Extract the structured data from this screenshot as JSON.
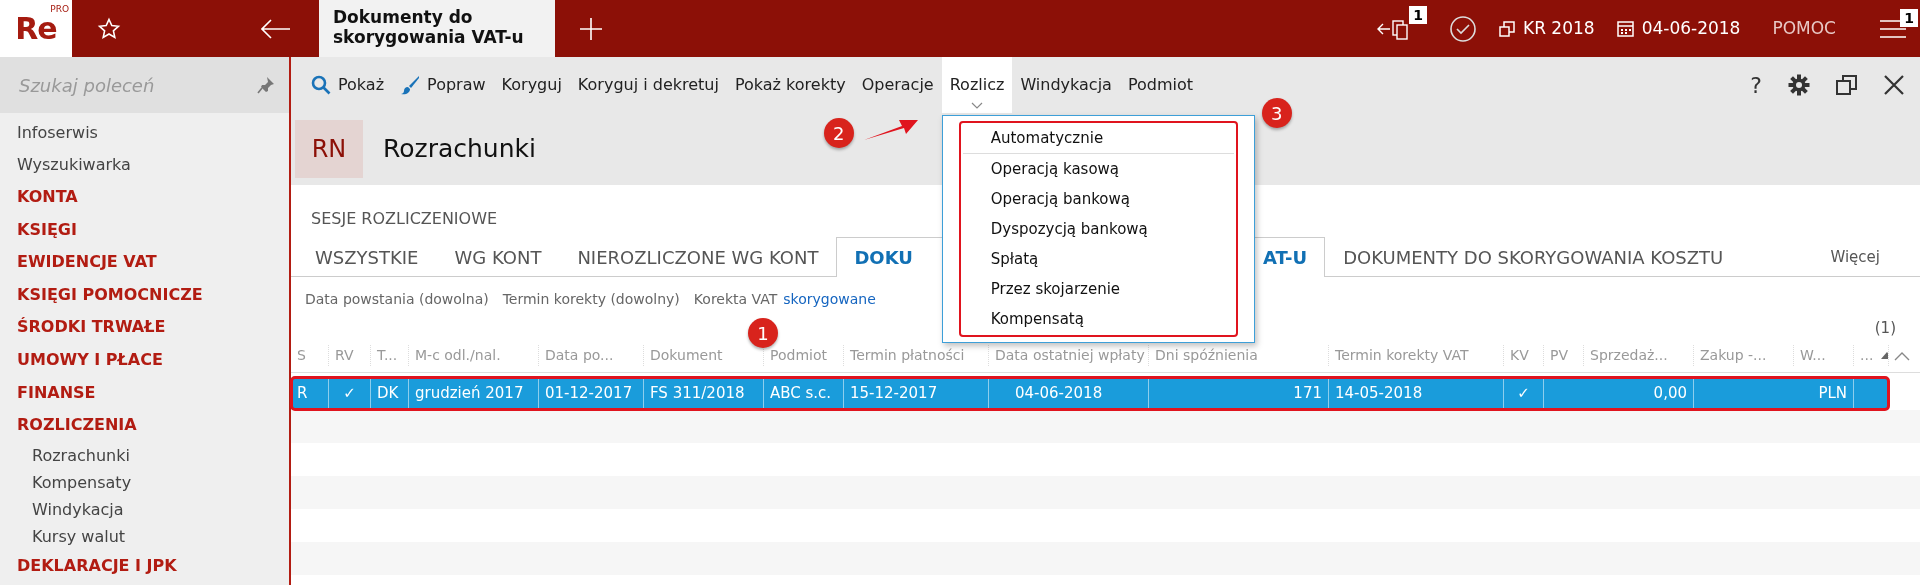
{
  "app": {
    "logo": "Re",
    "logo_badge": "PRO"
  },
  "document_tab": {
    "title": "Dokumenty do skorygowania VAT-u"
  },
  "status": {
    "notifications": "1",
    "year": "KR 2018",
    "date": "04-06-2018",
    "help": "POMOC",
    "menu_badge": "1"
  },
  "sidebar": {
    "search_placeholder": "Szukaj poleceń",
    "items": [
      {
        "label": "Infoserwis",
        "kind": "link"
      },
      {
        "label": "Wyszukiwarka",
        "kind": "link"
      },
      {
        "label": "KONTA",
        "kind": "section"
      },
      {
        "label": "KSIĘGI",
        "kind": "section"
      },
      {
        "label": "EWIDENCJE VAT",
        "kind": "section"
      },
      {
        "label": "KSIĘGI POMOCNICZE",
        "kind": "section"
      },
      {
        "label": "ŚRODKI TRWAŁE",
        "kind": "section"
      },
      {
        "label": "UMOWY I PŁACE",
        "kind": "section"
      },
      {
        "label": "FINANSE",
        "kind": "section"
      },
      {
        "label": "ROZLICZENIA",
        "kind": "section",
        "children": [
          {
            "label": "Rozrachunki"
          },
          {
            "label": "Kompensaty"
          },
          {
            "label": "Windykacja"
          },
          {
            "label": "Kursy walut"
          }
        ]
      },
      {
        "label": "DEKLARACJE I JPK",
        "kind": "section"
      }
    ]
  },
  "toolbar": {
    "items": [
      {
        "label": "Pokaż",
        "kind": "search",
        "selected": false
      },
      {
        "label": "Popraw",
        "kind": "brush",
        "selected": false
      },
      {
        "label": "Koryguj",
        "kind": "text",
        "selected": false
      },
      {
        "label": "Koryguj i dekretuj",
        "kind": "text",
        "selected": false
      },
      {
        "label": "Pokaż korekty",
        "kind": "text",
        "selected": false
      },
      {
        "label": "Operacje",
        "kind": "text",
        "selected": false
      },
      {
        "label": "Rozlicz",
        "kind": "text",
        "selected": true
      },
      {
        "label": "Windykacja",
        "kind": "text",
        "selected": false
      },
      {
        "label": "Podmiot",
        "kind": "text",
        "selected": false
      }
    ],
    "help": "?"
  },
  "module": {
    "code": "RN",
    "title": "Rozrachunki"
  },
  "sessions_label": "SESJE ROZLICZENIOWE",
  "tabs": [
    {
      "label": "WSZYSTKIE",
      "selected": false
    },
    {
      "label": "WG KONT",
      "selected": false
    },
    {
      "label": "NIEROZLICZONE WG KONT",
      "selected": false
    },
    {
      "label": "DOKU",
      "label_tail": "AT-U",
      "selected": true
    },
    {
      "label": "DOKUMENTY DO SKORYGOWANIA KOSZTU",
      "selected": false
    }
  ],
  "more": "Więcej",
  "filters": [
    {
      "label": "Data powstania (dowolna)"
    },
    {
      "label": "Termin korekty (dowolny)"
    },
    {
      "label": "Korekta VAT",
      "value": "skorygowane"
    }
  ],
  "count": "(1)",
  "table": {
    "columns": [
      "S",
      "RV",
      "T...",
      "M-c odl./nal.",
      "Data po...",
      "Dokument",
      "Podmiot",
      "Termin płatności",
      "Data ostatniej wpłaty",
      "Dni spóźnienia",
      "Termin korekty VAT",
      "KV",
      "PV",
      "Sprzedaż...",
      "Zakup -...",
      "W...",
      "..."
    ],
    "rows": [
      {
        "selected": true,
        "cells": [
          "R",
          "✓",
          "DK",
          "grudzień 2017",
          "01-12-2017",
          "FS 311/2018",
          "ABC s.c.",
          "15-12-2017",
          "04-06-2018",
          "171",
          "14-05-2018",
          "✓",
          "",
          "0,00",
          "",
          "PLN",
          ""
        ]
      }
    ]
  },
  "menu": {
    "items": [
      {
        "label": "Automatycznie",
        "separator_after": true
      },
      {
        "label": "Operacją kasową",
        "separator_after": false
      },
      {
        "label": "Operacją bankową",
        "separator_after": false
      },
      {
        "label": "Dyspozycją bankową",
        "separator_after": false
      },
      {
        "label": "Spłatą",
        "separator_after": false
      },
      {
        "label": "Przez skojarzenie",
        "separator_after": false
      },
      {
        "label": "Kompensatą",
        "separator_after": false
      }
    ]
  },
  "callouts": [
    "1",
    "2",
    "3"
  ]
}
